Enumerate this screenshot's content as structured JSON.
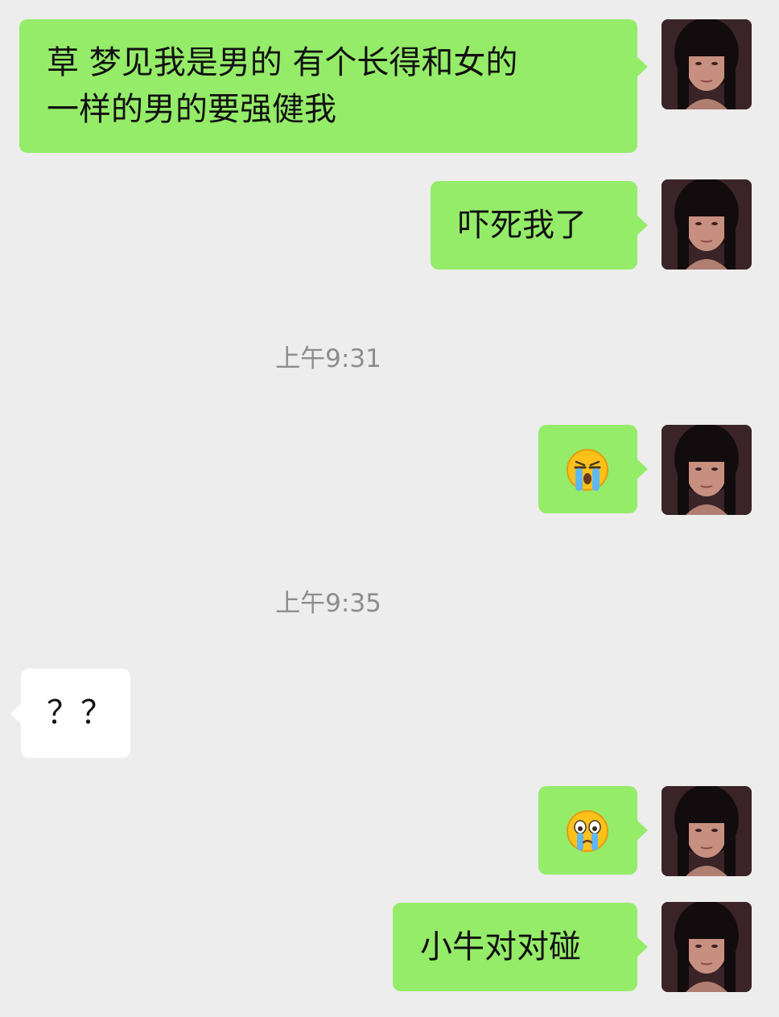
{
  "messages": [
    {
      "id": "m1",
      "from": "me",
      "line1": "草 梦见我是男的 有个长得和女的",
      "line2": "一样的男的要强健我"
    },
    {
      "id": "m2",
      "from": "me",
      "text": "吓死我了"
    },
    {
      "id": "t1",
      "timestamp": "上午9:31"
    },
    {
      "id": "m3",
      "from": "me",
      "emoji": "crying-face-emoji"
    },
    {
      "id": "t2",
      "timestamp": "上午9:35"
    },
    {
      "id": "m4",
      "from": "other",
      "text": "？？"
    },
    {
      "id": "m5",
      "from": "me",
      "emoji": "teary-face-emoji"
    },
    {
      "id": "m6",
      "from": "me",
      "text": "小牛对对碰"
    }
  ],
  "colors": {
    "background": "#ededed",
    "my_bubble": "#95ec69",
    "their_bubble": "#ffffff",
    "timestamp": "#8d8d8d"
  }
}
